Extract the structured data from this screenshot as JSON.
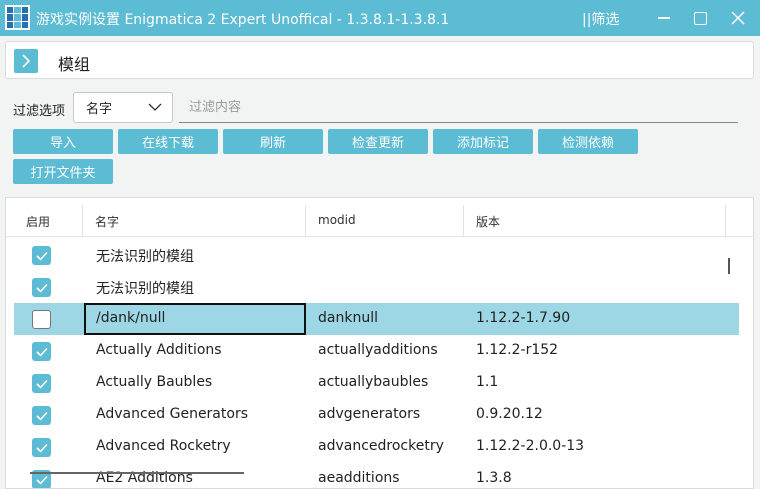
{
  "window": {
    "title": "游戏实例设置 Enigmatica 2 Expert Unoffical - 1.3.8.1-1.3.8.1",
    "filter_toggle": "||筛选"
  },
  "header": {
    "title": "模组"
  },
  "filter": {
    "label": "过滤选项",
    "selected": "名字",
    "placeholder": "过滤内容"
  },
  "toolbar": {
    "import": "导入",
    "download": "在线下载",
    "refresh": "刷新",
    "check_updates": "检查更新",
    "add_marker": "添加标记",
    "check_deps": "检测依赖",
    "open_folder": "打开文件夹"
  },
  "table": {
    "columns": [
      "启用",
      "名字",
      "modid",
      "版本"
    ],
    "rows": [
      {
        "enabled": true,
        "name": "无法识别的模组",
        "modid": "",
        "version": ""
      },
      {
        "enabled": true,
        "name": "无法识别的模组",
        "modid": "",
        "version": ""
      },
      {
        "enabled": false,
        "name": "/dank/null",
        "modid": "danknull",
        "version": "1.12.2-1.7.90"
      },
      {
        "enabled": true,
        "name": "Actually Additions",
        "modid": "actuallyadditions",
        "version": "1.12.2-r152"
      },
      {
        "enabled": true,
        "name": "Actually Baubles",
        "modid": "actuallybaubles",
        "version": "1.1"
      },
      {
        "enabled": true,
        "name": "Advanced Generators",
        "modid": "advgenerators",
        "version": "0.9.20.12"
      },
      {
        "enabled": true,
        "name": "Advanced Rocketry",
        "modid": "advancedrocketry",
        "version": "1.12.2-2.0.0-13"
      },
      {
        "enabled": true,
        "name": "AE2 Additions",
        "modid": "aeadditions",
        "version": "1.3.8"
      }
    ]
  },
  "colors": {
    "accent": "#5bbcd4",
    "selected_row": "#9dd6e4"
  }
}
